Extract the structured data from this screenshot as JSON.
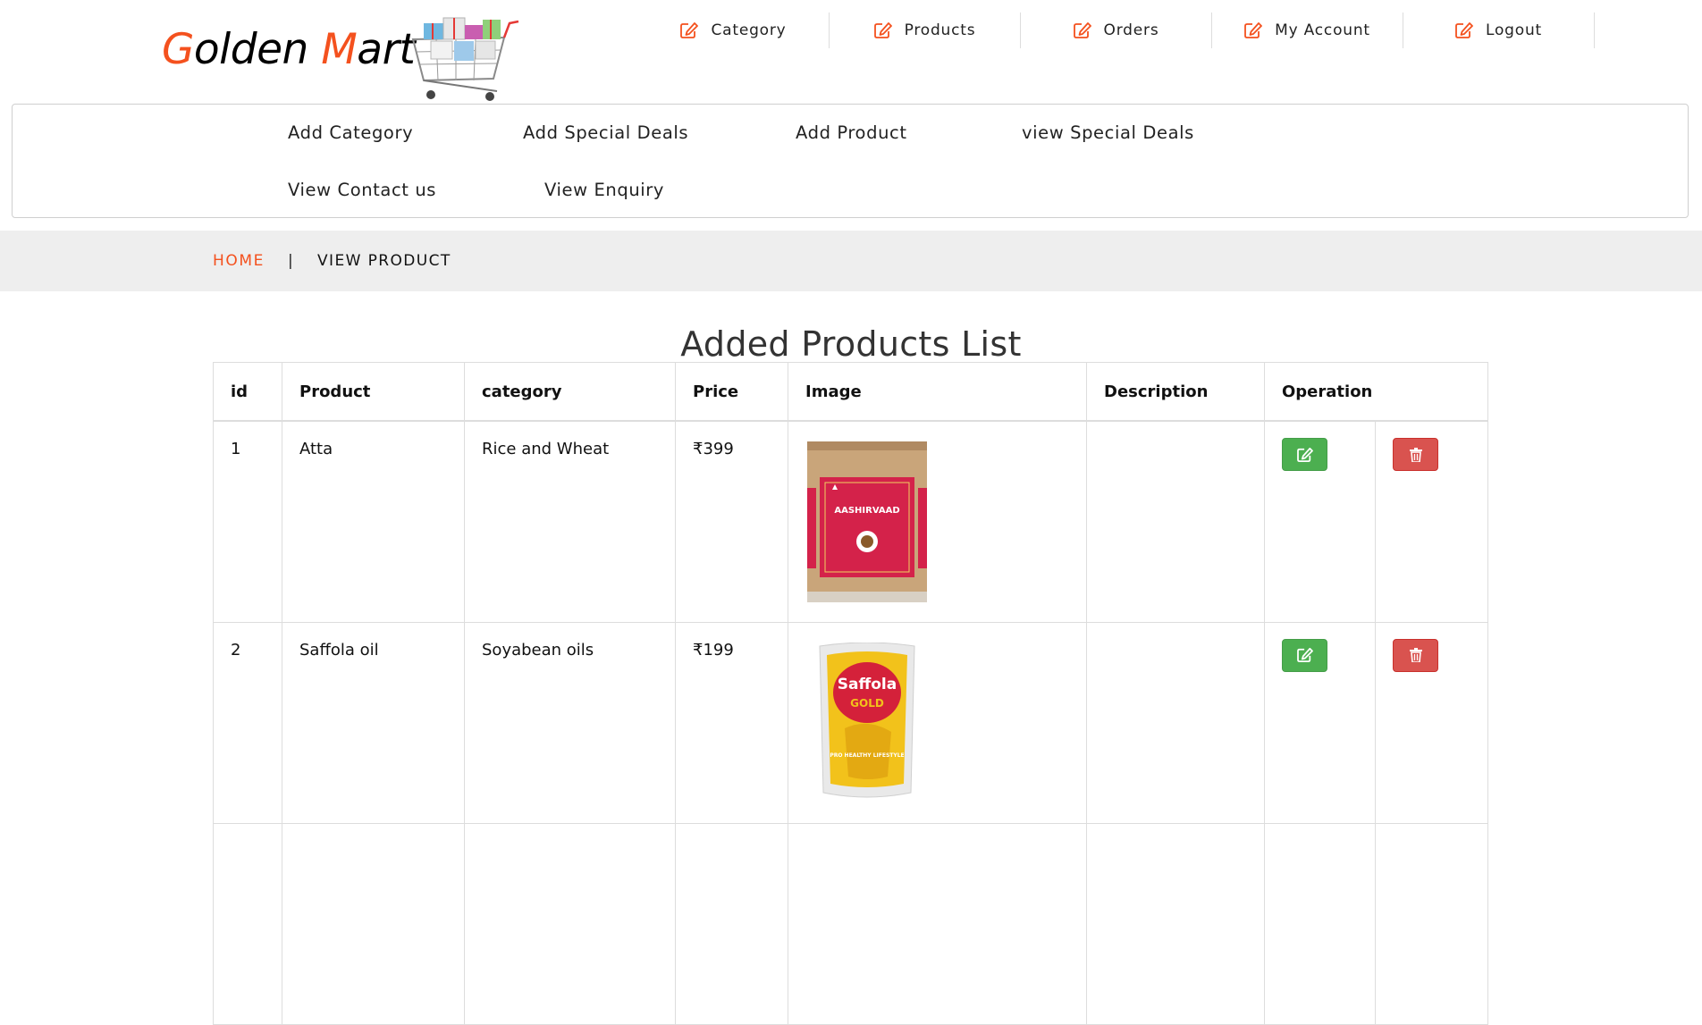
{
  "header": {
    "logo": {
      "g": "G",
      "olden": "olden ",
      "m": "M",
      "art": "art"
    },
    "nav": [
      {
        "label": "Category",
        "icon": "edit-icon"
      },
      {
        "label": "Products",
        "icon": "edit-icon"
      },
      {
        "label": "Orders",
        "icon": "edit-icon"
      },
      {
        "label": "My Account",
        "icon": "edit-icon"
      },
      {
        "label": "Logout",
        "icon": "edit-icon"
      }
    ]
  },
  "admin_menu": {
    "add_category": "Add Category",
    "add_special_deals": "Add Special Deals",
    "add_product": "Add Product",
    "view_special_deals": "view Special Deals",
    "view_contact_us": "View Contact us",
    "view_enquiry": "View Enquiry"
  },
  "breadcrumb": {
    "home": "HOME",
    "separator": "|",
    "current": "VIEW PRODUCT"
  },
  "products_list": {
    "title": "Added Products List",
    "columns": [
      "id",
      "Product",
      "category",
      "Price",
      "Image",
      "Description",
      "Operation"
    ],
    "rows": [
      {
        "id": "1",
        "product": "Atta",
        "category": "Rice and Wheat",
        "price": "₹399",
        "description": "",
        "image": {
          "brand": "AASHIRVAAD",
          "color": "#d4224a"
        }
      },
      {
        "id": "2",
        "product": "Saffola oil",
        "category": "Soyabean oils",
        "price": "₹199",
        "description": "",
        "image": {
          "brand": "Saffola",
          "sub": "GOLD",
          "tagline": "PRO HEALTHY LIFESTYLE",
          "color": "#f2c21b"
        }
      }
    ]
  },
  "colors": {
    "accent": "#f4511e",
    "edit_button": "#4caf50",
    "delete_button": "#d9534f",
    "breadcrumb_bg": "#eeeeee"
  }
}
